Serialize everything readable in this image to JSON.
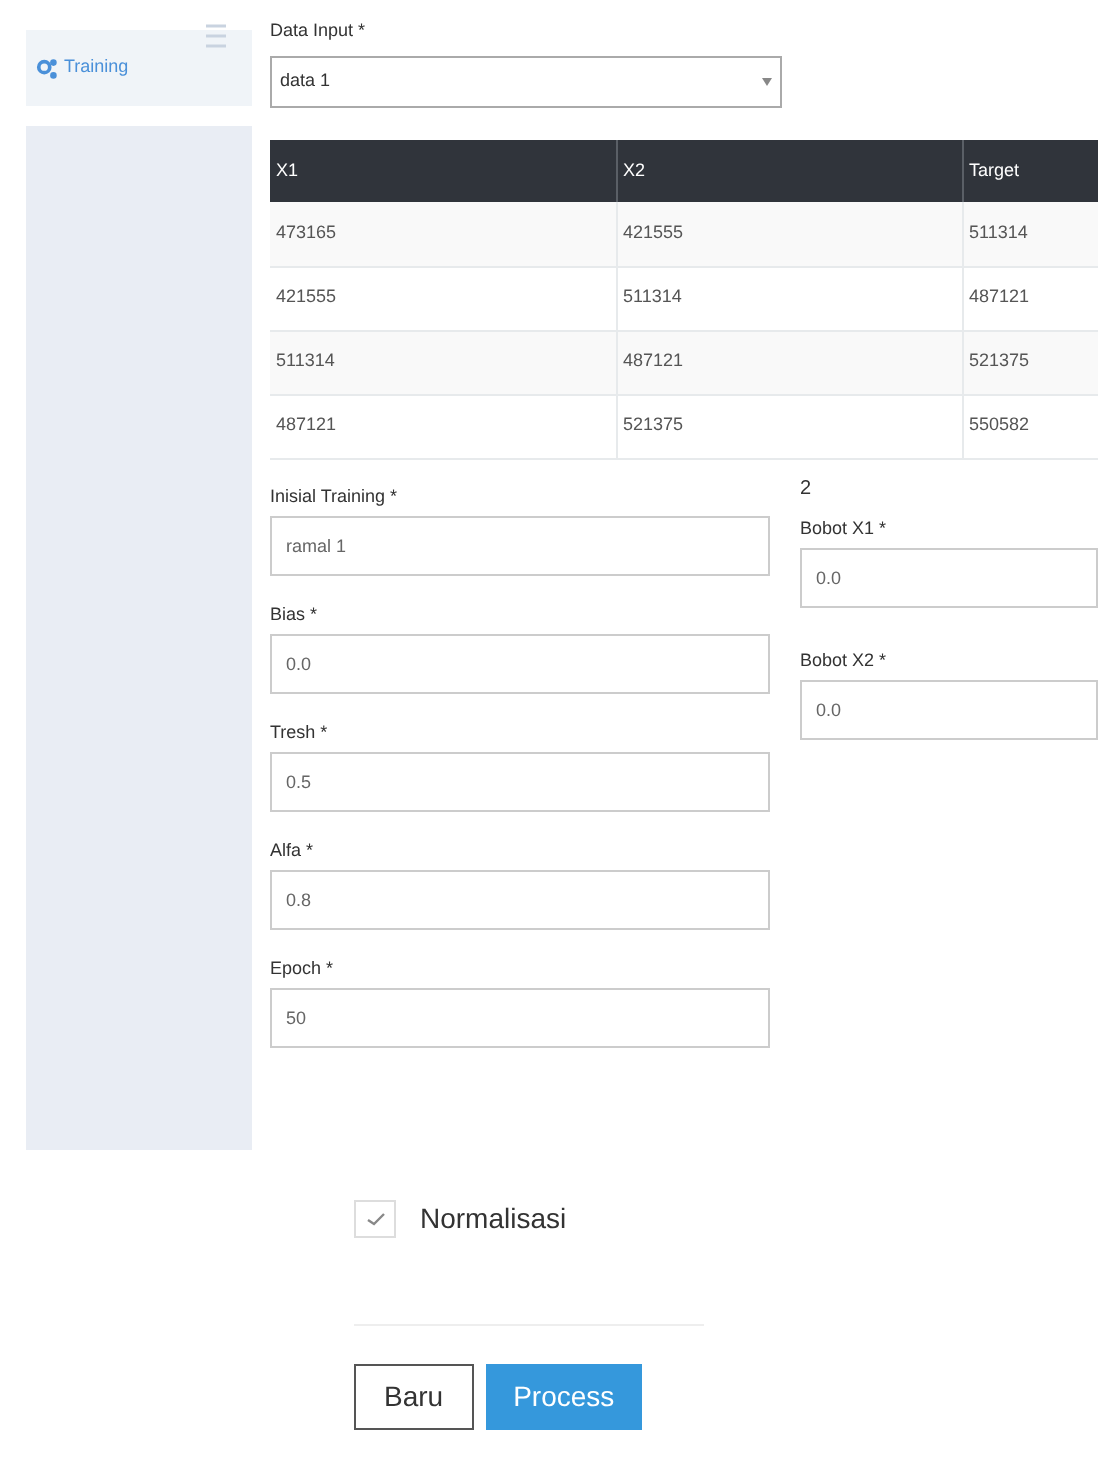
{
  "sidebar": {
    "items": [
      {
        "label": "Training",
        "selected": true
      }
    ]
  },
  "data_input": {
    "label": "Data Input *",
    "value": "data 1"
  },
  "table": {
    "columns": [
      "X1",
      "X2",
      "Target"
    ],
    "rows": [
      [
        "473165",
        "421555",
        "511314"
      ],
      [
        "421555",
        "511314",
        "487121"
      ],
      [
        "511314",
        "487121",
        "521375"
      ],
      [
        "487121",
        "521375",
        "550582"
      ]
    ]
  },
  "left_fields": [
    {
      "label": "Inisial Training *",
      "value": "ramal 1"
    },
    {
      "label": "Bias *",
      "value": "0.0"
    },
    {
      "label": "Tresh *",
      "value": "0.5"
    },
    {
      "label": "Alfa *",
      "value": "0.8"
    },
    {
      "label": "Epoch *",
      "value": "50"
    }
  ],
  "right_heading": "2",
  "right_fields": [
    {
      "label": "Bobot X1 *",
      "value": "0.0"
    },
    {
      "label": "Bobot X2 *",
      "value": "0.0"
    }
  ],
  "normalisasi": {
    "label": "Normalisasi",
    "checked": true
  },
  "buttons": [
    {
      "label": "Baru",
      "kind": "outline"
    },
    {
      "label": "Process",
      "kind": "primary"
    }
  ]
}
